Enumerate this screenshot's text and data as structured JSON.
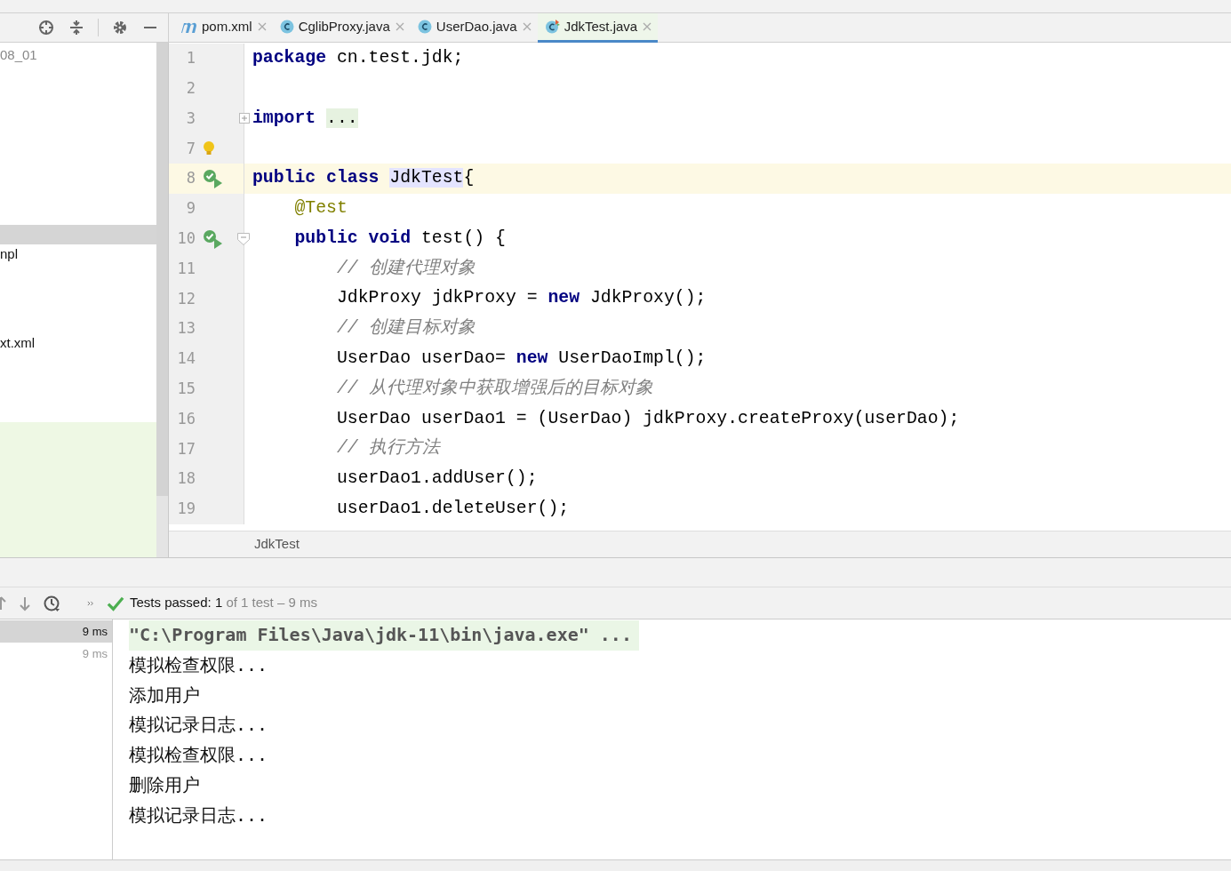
{
  "editor_tabs": [
    {
      "label": "pom.xml",
      "kind": "maven",
      "selected": false
    },
    {
      "label": "CglibProxy.java",
      "kind": "class",
      "selected": false
    },
    {
      "label": "UserDao.java",
      "kind": "class",
      "selected": false
    },
    {
      "label": "JdkTest.java",
      "kind": "test-class",
      "selected": true
    }
  ],
  "project_tree": {
    "rows": [
      {
        "text": "08_01",
        "muted": true,
        "selected": false
      },
      {
        "selected": true
      },
      {
        "text": "npl",
        "muted": false,
        "selected": false
      },
      {
        "text": "xt.xml",
        "muted": false,
        "selected": false
      }
    ]
  },
  "code_lines": [
    {
      "number": "1",
      "tokens": [
        {
          "kind": "keyword",
          "text": "package"
        },
        {
          "kind": "plain",
          "text": " cn.test.jdk;"
        }
      ]
    },
    {
      "number": "2"
    },
    {
      "number": "3",
      "foldable": true,
      "folded": true,
      "tokens": [
        {
          "kind": "keyword",
          "text": "import "
        },
        {
          "kind": "folded",
          "text": "..."
        }
      ]
    },
    {
      "number": "7",
      "intention_bulb": true
    },
    {
      "number": "8",
      "run_marker": true,
      "current": true,
      "tokens": [
        {
          "kind": "keyword",
          "text": "public class "
        },
        {
          "kind": "symbol",
          "text": "JdkTest"
        },
        {
          "kind": "plain",
          "text": "{"
        }
      ]
    },
    {
      "number": "9",
      "tokens": [
        {
          "kind": "annotation",
          "text": "    @Test"
        }
      ]
    },
    {
      "number": "10",
      "run_marker": true,
      "foldable": true,
      "folded": false,
      "tokens": [
        {
          "kind": "keyword",
          "text": "    public void"
        },
        {
          "kind": "plain",
          "text": " test() {"
        }
      ]
    },
    {
      "number": "11",
      "tokens": [
        {
          "kind": "comment",
          "text": "        // 创建代理对象"
        }
      ]
    },
    {
      "number": "12",
      "tokens": [
        {
          "kind": "plain",
          "text": "        JdkProxy jdkProxy = "
        },
        {
          "kind": "keyword",
          "text": "new"
        },
        {
          "kind": "plain",
          "text": " JdkProxy();"
        }
      ]
    },
    {
      "number": "13",
      "tokens": [
        {
          "kind": "comment",
          "text": "        // 创建目标对象"
        }
      ]
    },
    {
      "number": "14",
      "tokens": [
        {
          "kind": "plain",
          "text": "        UserDao userDao= "
        },
        {
          "kind": "keyword",
          "text": "new"
        },
        {
          "kind": "plain",
          "text": " UserDaoImpl();"
        }
      ]
    },
    {
      "number": "15",
      "tokens": [
        {
          "kind": "comment",
          "text": "        // 从代理对象中获取增强后的目标对象"
        }
      ]
    },
    {
      "number": "16",
      "tokens": [
        {
          "kind": "plain",
          "text": "        UserDao userDao1 = (UserDao) jdkProxy.createProxy(userDao);"
        }
      ]
    },
    {
      "number": "17",
      "tokens": [
        {
          "kind": "comment",
          "text": "        // 执行方法"
        }
      ]
    },
    {
      "number": "18",
      "tokens": [
        {
          "kind": "plain",
          "text": "        userDao1.addUser();"
        }
      ]
    },
    {
      "number": "19",
      "tokens": [
        {
          "kind": "plain",
          "text": "        userDao1.deleteUser();"
        }
      ]
    }
  ],
  "editor_breadcrumb": "JdkTest",
  "run_status": {
    "passed": true,
    "label": "Tests passed:",
    "count": "1",
    "detail": "of 1 test – 9 ms"
  },
  "test_tree": [
    {
      "time": "9 ms",
      "selected": true
    },
    {
      "time": "9 ms",
      "selected": false
    }
  ],
  "console_lines": [
    {
      "kind": "command",
      "text": "\"C:\\Program Files\\Java\\jdk-11\\bin\\java.exe\" ..."
    },
    {
      "kind": "output",
      "text": "模拟检查权限..."
    },
    {
      "kind": "output",
      "text": "添加用户"
    },
    {
      "kind": "output",
      "text": "模拟记录日志..."
    },
    {
      "kind": "output",
      "text": "模拟检查权限..."
    },
    {
      "kind": "output",
      "text": "删除用户"
    },
    {
      "kind": "output",
      "text": "模拟记录日志..."
    }
  ]
}
